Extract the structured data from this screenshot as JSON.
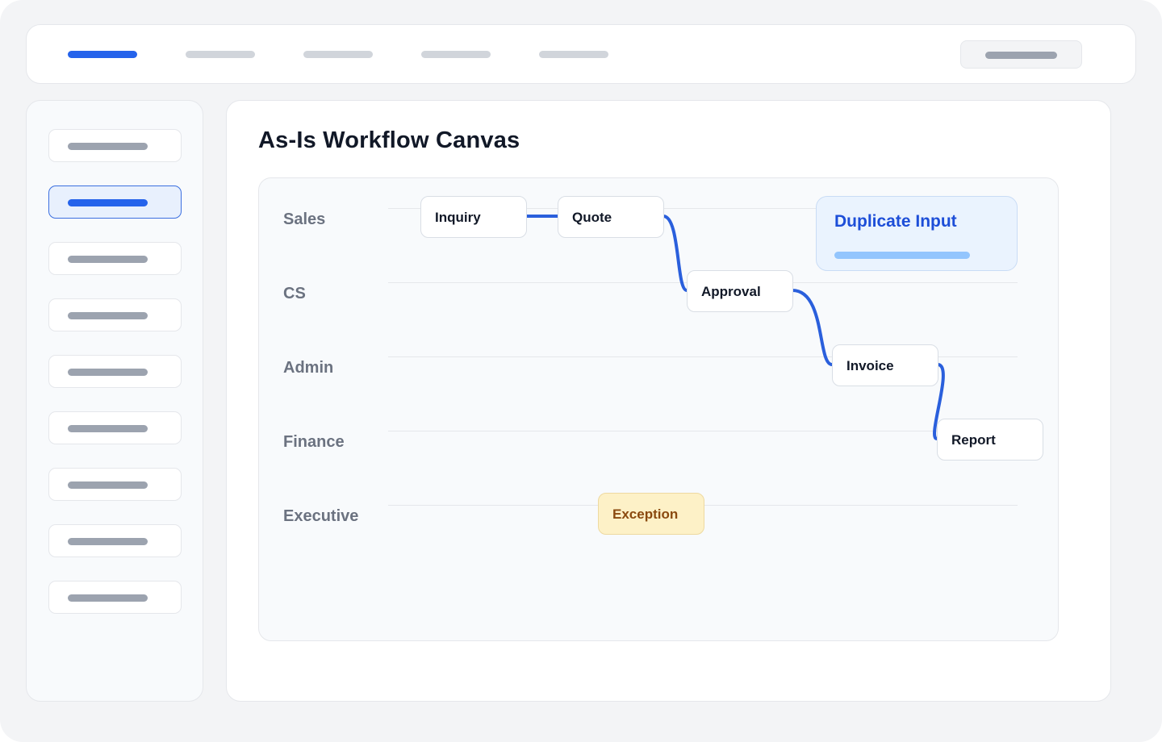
{
  "page": {
    "title": "As-Is Workflow Canvas"
  },
  "colors": {
    "accent": "#2563eb",
    "connector": "#2a5fdc",
    "exception_bg": "#fdf1c7",
    "exception_text": "#8a4a0f",
    "callout_bg": "#eaf3fe",
    "callout_text": "#1d4ed8"
  },
  "lanes": [
    "Sales",
    "CS",
    "Admin",
    "Finance",
    "Executive"
  ],
  "nodes": {
    "inquiry": "Inquiry",
    "quote": "Quote",
    "approval": "Approval",
    "invoice": "Invoice",
    "report": "Report",
    "exception": "Exception"
  },
  "callout": {
    "title": "Duplicate Input"
  }
}
